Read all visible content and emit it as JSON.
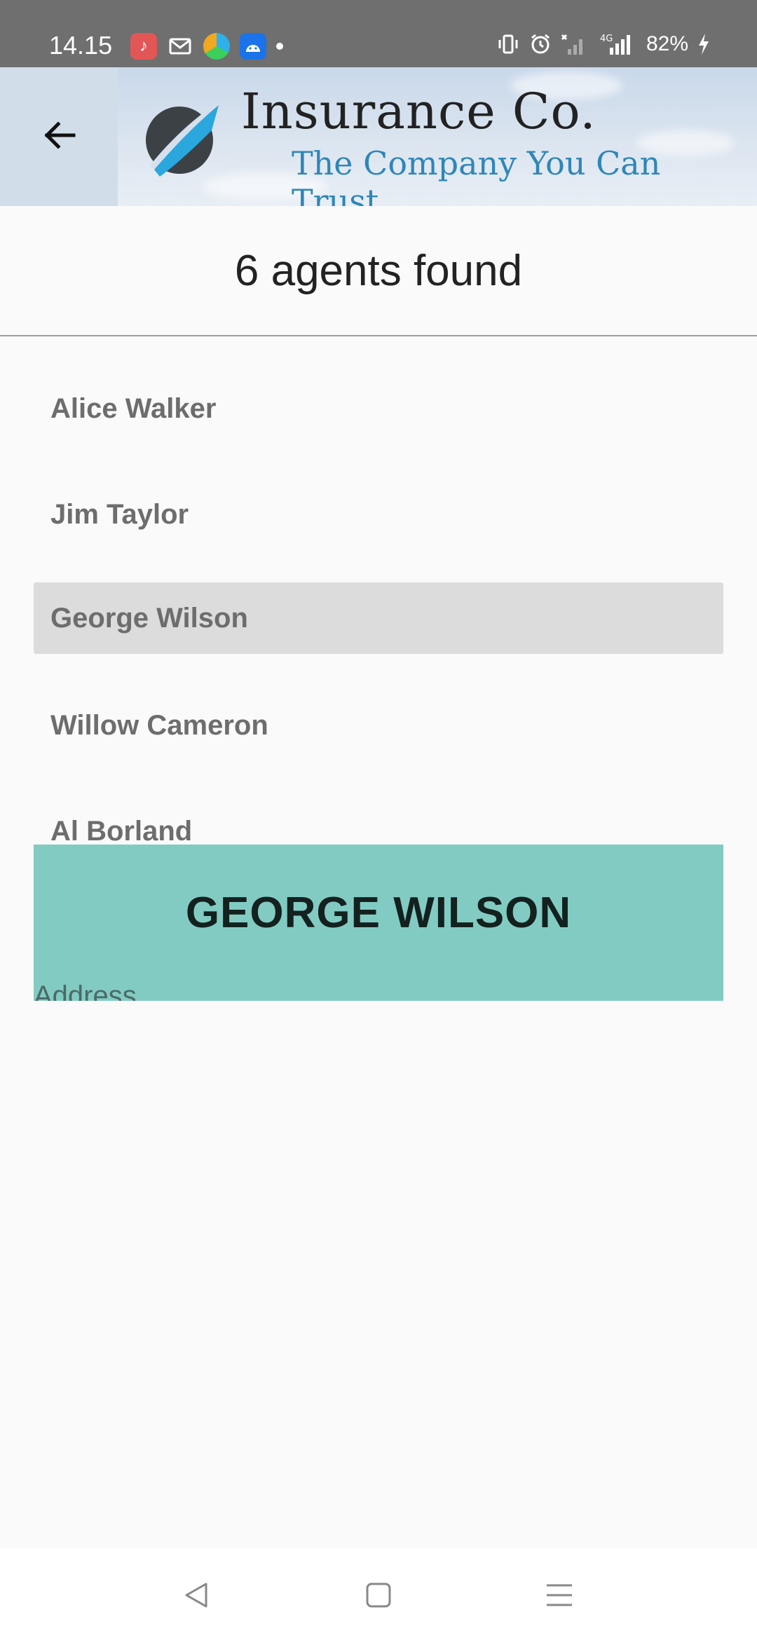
{
  "status_bar": {
    "time": "14.15",
    "battery_percent": "82%",
    "icons": [
      "music-app-icon",
      "mail-icon",
      "browser-icon",
      "android-icon",
      "notification-dot-icon",
      "vibrate-icon",
      "alarm-icon",
      "no-signal-icon",
      "4g-signal-icon",
      "charging-icon"
    ]
  },
  "header": {
    "back_icon": "arrow-left-icon",
    "brand_title": "Insurance Co.",
    "brand_tagline": "The Company You Can Trust",
    "logo_icon": "swoosh-logo-icon"
  },
  "results": {
    "heading": "6 agents found"
  },
  "agents": [
    {
      "name": "Alice Walker",
      "selected": false
    },
    {
      "name": "Jim Taylor",
      "selected": false
    },
    {
      "name": "George Wilson",
      "selected": true
    },
    {
      "name": "Willow Cameron",
      "selected": false
    },
    {
      "name": "Al Borland",
      "selected": false
    }
  ],
  "detail": {
    "name": "GEORGE WILSON",
    "address_label": "Address"
  },
  "nav_bar": {
    "icons": [
      "back-triangle-icon",
      "home-square-icon",
      "menu-lines-icon"
    ]
  },
  "colors": {
    "status_bar_bg": "#6f6f6f",
    "selected_row_bg": "#dcdcdc",
    "detail_panel_bg": "#82cbc3",
    "tagline": "#2f86b8"
  }
}
